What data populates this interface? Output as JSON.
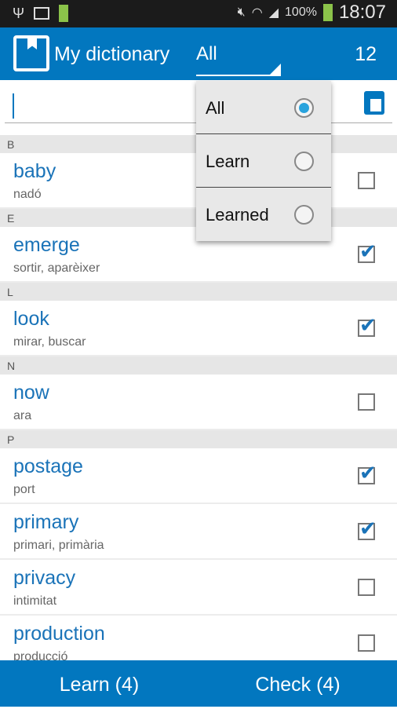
{
  "status": {
    "battery_small": "100%",
    "battery": "100%",
    "time": "18:07"
  },
  "appbar": {
    "title": "My dictionary",
    "filter": "All",
    "count": "12"
  },
  "search": {
    "value": ""
  },
  "filter_menu": [
    {
      "label": "All",
      "selected": true
    },
    {
      "label": "Learn",
      "selected": false
    },
    {
      "label": "Learned",
      "selected": false
    }
  ],
  "list": [
    {
      "header": "B",
      "items": [
        {
          "word": "baby",
          "translation": "nadó",
          "checked": false
        }
      ]
    },
    {
      "header": "E",
      "items": [
        {
          "word": "emerge",
          "translation": "sortir, aparèixer",
          "checked": true
        }
      ]
    },
    {
      "header": "L",
      "items": [
        {
          "word": "look",
          "translation": "mirar, buscar",
          "checked": true
        }
      ]
    },
    {
      "header": "N",
      "items": [
        {
          "word": "now",
          "translation": "ara",
          "checked": false
        }
      ]
    },
    {
      "header": "P",
      "items": [
        {
          "word": "postage",
          "translation": "port",
          "checked": true
        },
        {
          "word": "primary",
          "translation": "primari, primària",
          "checked": true
        },
        {
          "word": "privacy",
          "translation": "intimitat",
          "checked": false
        },
        {
          "word": "production",
          "translation": "producció",
          "checked": false
        }
      ]
    }
  ],
  "bottom": {
    "learn": "Learn (4)",
    "check": "Check (4)"
  },
  "colors": {
    "primary": "#0277bf",
    "word": "#1a73b8"
  }
}
